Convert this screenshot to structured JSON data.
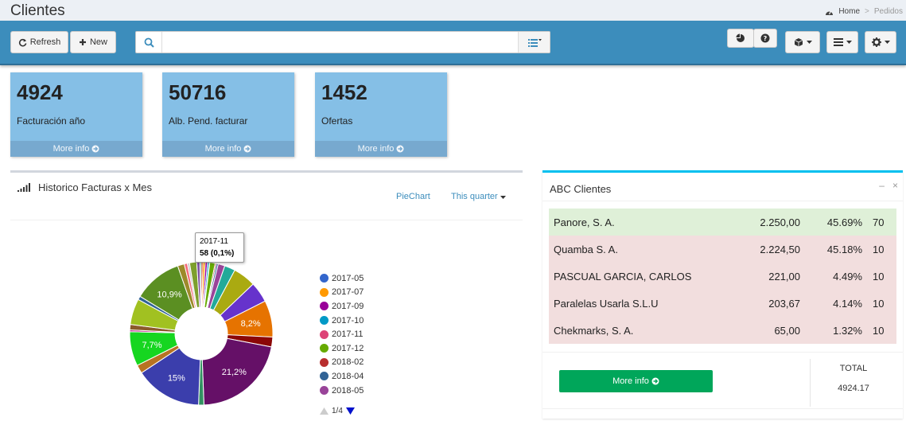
{
  "header": {
    "title": "Clientes",
    "breadcrumb": {
      "home": "Home",
      "current": "Pedidos"
    }
  },
  "toolbar": {
    "refresh_label": "Refresh",
    "new_label": "New",
    "search": {
      "value": "",
      "placeholder": ""
    }
  },
  "cards": [
    {
      "value": "4924",
      "label": "Facturación año",
      "more": "More info"
    },
    {
      "value": "50716",
      "label": "Alb. Pend. facturar",
      "more": "More info"
    },
    {
      "value": "1452",
      "label": "Ofertas",
      "more": "More info"
    }
  ],
  "chart_panel": {
    "title": "Historico Facturas x Mes",
    "type_link": "PieChart",
    "period_link": "This quarter",
    "tooltip": {
      "label": "2017-11",
      "value": "58 (0,1%)"
    },
    "pager": "1/4"
  },
  "chart_data": {
    "type": "pie",
    "title": "Historico Facturas x Mes",
    "legend_position": "right",
    "legend": [
      {
        "name": "2017-05",
        "color": "#3366cc"
      },
      {
        "name": "2017-07",
        "color": "#ff9900"
      },
      {
        "name": "2017-09",
        "color": "#990099"
      },
      {
        "name": "2017-10",
        "color": "#0099c6"
      },
      {
        "name": "2017-11",
        "color": "#dd4477"
      },
      {
        "name": "2017-12",
        "color": "#66aa00"
      },
      {
        "name": "2018-02",
        "color": "#b82e2e"
      },
      {
        "name": "2018-04",
        "color": "#316395"
      },
      {
        "name": "2018-05",
        "color": "#994499"
      }
    ],
    "slices": [
      {
        "color": "#dc3912",
        "value": 0.4
      },
      {
        "color": "#ff9900",
        "value": 0.5
      },
      {
        "color": "#990099",
        "value": 0.5
      },
      {
        "color": "#0099c6",
        "value": 0.4
      },
      {
        "color": "#dd4477",
        "value": 0.1
      },
      {
        "color": "#66aa00",
        "value": 1.2
      },
      {
        "color": "#b82e2e",
        "value": 0.3
      },
      {
        "color": "#316395",
        "value": 0.4
      },
      {
        "color": "#994499",
        "value": 1.5
      },
      {
        "color": "#22aa99",
        "value": 2.4
      },
      {
        "color": "#aaaa11",
        "value": 5.1
      },
      {
        "color": "#6633cc",
        "value": 4.6
      },
      {
        "color": "#e67300",
        "value": 8.2,
        "label": "8,2%"
      },
      {
        "color": "#8b0707",
        "value": 2.2
      },
      {
        "color": "#651067",
        "value": 21.2,
        "label": "21,2%"
      },
      {
        "color": "#329262",
        "value": 1.2
      },
      {
        "color": "#3b3eac",
        "value": 15,
        "label": "15%"
      },
      {
        "color": "#b77322",
        "value": 1.9
      },
      {
        "color": "#16d620",
        "value": 7.7,
        "label": "7,7%"
      },
      {
        "color": "#b91383",
        "value": 0.4
      },
      {
        "color": "#8b5a2b",
        "value": 1.2
      },
      {
        "color": "#a1c121",
        "value": 5.8
      },
      {
        "color": "#316395",
        "value": 0.8
      },
      {
        "color": "#5b8f22",
        "value": 10.9,
        "label": "10,9%"
      },
      {
        "color": "#9d8a2a",
        "value": 1.5
      },
      {
        "color": "#f36c7b",
        "value": 0.7
      },
      {
        "color": "#cccccc",
        "value": 0.5
      },
      {
        "color": "#7d9f2c",
        "value": 1.6
      },
      {
        "color": "#7b4fa0",
        "value": 0.7
      },
      {
        "color": "#15b2b0",
        "value": 0.3
      }
    ]
  },
  "abc_panel": {
    "title": "ABC Clientes",
    "rows": [
      {
        "name": "Panore, S. A.",
        "amount": "2.250,00",
        "pct": "45.69%",
        "count": "70",
        "color": "#dff0d8"
      },
      {
        "name": "Quamba S. A.",
        "amount": "2.224,50",
        "pct": "45.18%",
        "count": "10",
        "color": "#f2dede"
      },
      {
        "name": "PASCUAL GARCIA, CARLOS",
        "amount": "221,00",
        "pct": "4.49%",
        "count": "10",
        "color": "#f2dede"
      },
      {
        "name": "Paralelas Usarla S.L.U",
        "amount": "203,67",
        "pct": "4.14%",
        "count": "10",
        "color": "#f2dede"
      },
      {
        "name": "Chekmarks, S. A.",
        "amount": "65,00",
        "pct": "1.32%",
        "count": "10",
        "color": "#f2dede"
      }
    ],
    "more": "More info",
    "total_label": "TOTAL",
    "total_value": "4924.17"
  }
}
